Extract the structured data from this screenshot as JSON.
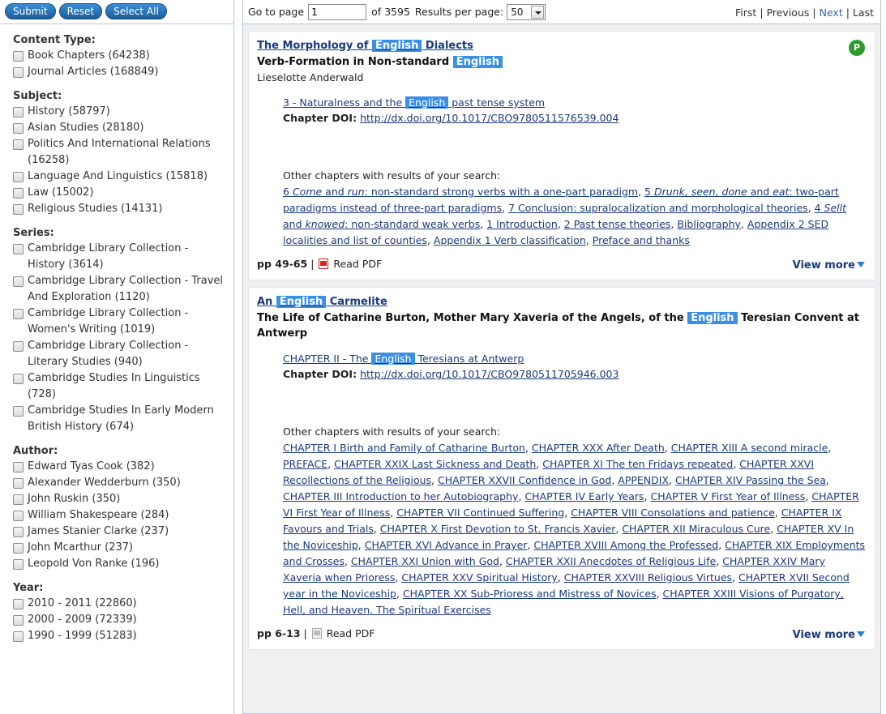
{
  "sidebar": {
    "buttons": {
      "submit": "Submit",
      "reset": "Reset",
      "select_all": "Select All"
    },
    "facets": [
      {
        "title": "Content Type:",
        "items": [
          "Book Chapters (64238)",
          "Journal Articles (168849)"
        ]
      },
      {
        "title": "Subject:",
        "items": [
          "History (58797)",
          "Asian Studies (28180)",
          "Politics And International Relations (16258)",
          "Language And Linguistics (15818)",
          "Law (15002)",
          "Religious Studies (14131)"
        ]
      },
      {
        "title": "Series:",
        "items": [
          "Cambridge Library Collection - History (3614)",
          "Cambridge Library Collection - Travel And Exploration (1120)",
          "Cambridge Library Collection - Women's Writing (1019)",
          "Cambridge Library Collection - Literary Studies (940)",
          "Cambridge Studies In Linguistics (728)",
          "Cambridge Studies In Early Modern British History (674)"
        ]
      },
      {
        "title": "Author:",
        "items": [
          "Edward Tyas Cook (382)",
          "Alexander Wedderburn (350)",
          "John Ruskin (350)",
          "William Shakespeare (284)",
          "James Stanier Clarke (237)",
          "John Mcarthur (237)",
          "Leopold Von Ranke (196)"
        ]
      },
      {
        "title": "Year:",
        "items": [
          "2010 - 2011 (22860)",
          "2000 - 2009 (72339)",
          "1990 - 1999 (51283)"
        ]
      }
    ]
  },
  "pager": {
    "go_to_label": "Go to page",
    "page_value": "1",
    "of_pages": "of 3595",
    "rpp_label": "Results per page:",
    "rpp_value": "50",
    "first": "First",
    "previous": "Previous",
    "next": "Next",
    "last": "Last"
  },
  "highlight_term": "English",
  "results": [
    {
      "title_pre": "The Morphology of ",
      "title_post": " Dialects",
      "subtitle_pre": "Verb-Formation in Non-standard ",
      "subtitle_post": "",
      "author": "Lieselotte Anderwald",
      "badge": "P",
      "chapter_pre": "3 - Naturalness and the ",
      "chapter_post": " past tense system",
      "doi_label": "Chapter DOI:",
      "doi": "http://dx.doi.org/10.1017/CBO9780511576539.004",
      "other_label": "Other chapters with results of your search:",
      "other_chapters": [
        "6 Come and run: non-standard strong verbs with a one-part paradigm",
        "5 Drunk, seen, done and eat: two-part paradigms instead of three-part paradigms",
        "7 Conclusion: supralocalization and morphological theories",
        "4 Sellt and knowed: non-standard weak verbs",
        "1 Introduction",
        "2 Past tense theories",
        "Bibliography",
        "Appendix 2 SED localities and list of counties",
        "Appendix 1 Verb classification",
        "Preface and thanks"
      ],
      "pages": "pp 49-65",
      "read_pdf": "Read PDF",
      "view_more": "View more"
    },
    {
      "title_pre": "An ",
      "title_post": " Carmelite",
      "subtitle_pre": "The Life of Catharine Burton, Mother Mary Xaveria of the Angels, of the ",
      "subtitle_post": " Teresian Convent at Antwerp",
      "author": "",
      "badge": "",
      "chapter_pre": "CHAPTER II - The ",
      "chapter_post": " Teresians at Antwerp",
      "doi_label": "Chapter DOI:",
      "doi": "http://dx.doi.org/10.1017/CBO9780511705946.003",
      "other_label": "Other chapters with results of your search:",
      "other_chapters": [
        "CHAPTER I Birth and Family of Catharine Burton",
        "CHAPTER XXX After Death",
        "CHAPTER XIII A second miracle",
        "PREFACE",
        "CHAPTER XXIX Last Sickness and Death",
        "CHAPTER XI The ten Fridays repeated",
        "CHAPTER XXVI Recollections of the Religious",
        "CHAPTER XXVII Confidence in God",
        "APPENDIX",
        "CHAPTER XIV Passing the Sea",
        "CHAPTER III Introduction to her Autobiography",
        "CHAPTER IV Early Years",
        "CHAPTER V First Year of Illness",
        "CHAPTER VI First Year of Illness",
        "CHAPTER VII Continued Suffering",
        "CHAPTER VIII Consolations and patience",
        "CHAPTER IX Favours and Trials",
        "CHAPTER X First Devotion to St. Francis Xavier",
        "CHAPTER XII Miraculous Cure",
        "CHAPTER XV In the Noviceship",
        "CHAPTER XVI Advance in Prayer",
        "CHAPTER XVIII Among the Professed",
        "CHAPTER XIX Employments and Crosses",
        "CHAPTER XXI Union with God",
        "CHAPTER XXII Anecdotes of Religious Life",
        "CHAPTER XXIV Mary Xaveria when Prioress",
        "CHAPTER XXV Spiritual History",
        "CHAPTER XXVIII Religious Virtues",
        "CHAPTER XVII Second year in the Noviceship",
        "CHAPTER XX Sub-Prioress and Mistress of Novices",
        "CHAPTER XXIII Visions of Purgatory, Hell, and Heaven. The Spiritual Exercises"
      ],
      "pages": "pp 6-13",
      "read_pdf": "Read PDF",
      "view_more": "View more"
    }
  ],
  "colors": {
    "accent": "#3b8fe5",
    "link": "#1a3a7a",
    "badge": "#2f9a2f"
  },
  "icons": {
    "pdf": "pdf-icon",
    "dropdown": "chevron-down-icon",
    "view_more": "triangle-down-icon"
  }
}
